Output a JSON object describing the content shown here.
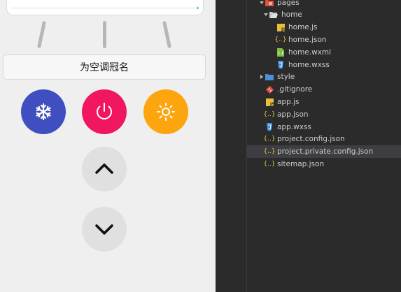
{
  "phone": {
    "rename_label": "为空调冠名",
    "colors": {
      "cool": "#3f4fbf",
      "power": "#f0165f",
      "heat": "#fca50f",
      "control_gray": "#e0e0e0"
    },
    "buttons": [
      {
        "name": "mode-cool-button",
        "icon": "snowflake-icon"
      },
      {
        "name": "power-button",
        "icon": "power-icon"
      },
      {
        "name": "mode-heat-button",
        "icon": "sun-icon"
      },
      {
        "name": "temperature-up-button",
        "icon": "chevron-up-icon"
      },
      {
        "name": "temperature-down-button",
        "icon": "chevron-down-icon"
      }
    ]
  },
  "explorer": {
    "items": [
      {
        "label": "pages",
        "type": "folder",
        "icon": "folder-red-icon",
        "expanded": true
      },
      {
        "label": "home",
        "type": "folder",
        "icon": "folder-open-icon",
        "expanded": true
      },
      {
        "label": "home.js",
        "type": "file",
        "icon": "js-file-icon"
      },
      {
        "label": "home.json",
        "type": "file",
        "icon": "json-file-icon"
      },
      {
        "label": "home.wxml",
        "type": "file",
        "icon": "wxml-file-icon"
      },
      {
        "label": "home.wxss",
        "type": "file",
        "icon": "wxss-file-icon"
      },
      {
        "label": "style",
        "type": "folder",
        "icon": "folder-blue-icon",
        "expanded": false
      },
      {
        "label": ".gitignore",
        "type": "file",
        "icon": "git-file-icon"
      },
      {
        "label": "app.js",
        "type": "file",
        "icon": "js-file-icon"
      },
      {
        "label": "app.json",
        "type": "file",
        "icon": "json-file-icon"
      },
      {
        "label": "app.wxss",
        "type": "file",
        "icon": "wxss-file-icon"
      },
      {
        "label": "project.config.json",
        "type": "file",
        "icon": "json-file-icon"
      },
      {
        "label": "project.private.config.json",
        "type": "file",
        "icon": "json-file-icon",
        "selected": true
      },
      {
        "label": "sitemap.json",
        "type": "file",
        "icon": "json-file-icon"
      }
    ]
  }
}
